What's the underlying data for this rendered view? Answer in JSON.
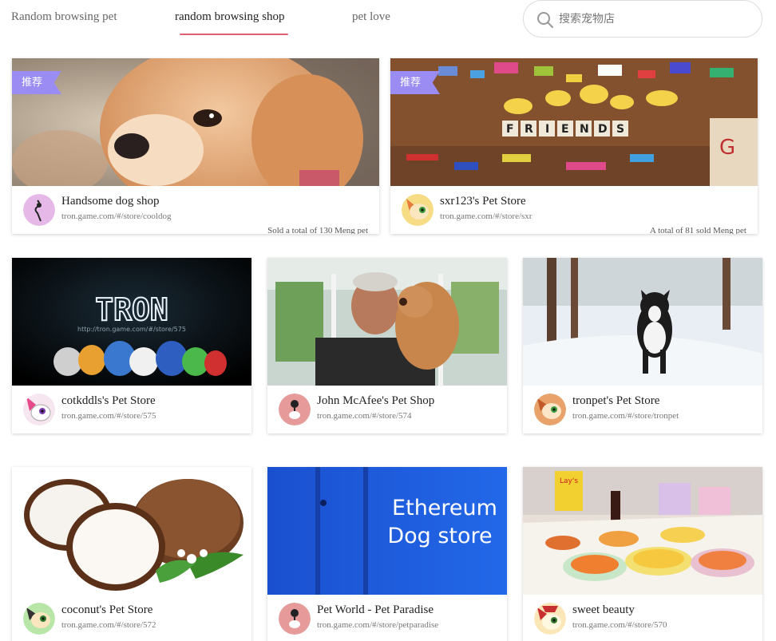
{
  "nav": {
    "tabs": [
      {
        "label": "Random browsing pet"
      },
      {
        "label": "random browsing shop"
      },
      {
        "label": "pet love"
      }
    ],
    "active_tab": "random browsing shop",
    "accent_color": "#e0606e"
  },
  "search": {
    "placeholder": "搜索宠物店",
    "value": ""
  },
  "badge_color": "#9a8cf2",
  "featured": [
    {
      "badge": "推荐",
      "name": "Handsome dog shop",
      "url": "tron.game.com/#/store/cooldog",
      "sold": "Sold a total of 130 Meng pet",
      "image": "puppy-photo",
      "avatar": "cat-avatar-purple"
    },
    {
      "badge": "推荐",
      "name": "sxr123's Pet Store",
      "url": "tron.game.com/#/store/sxr",
      "sold": "A total of 81 sold Meng pet",
      "image": "toys-friends-photo",
      "avatar": "cat-avatar-yellow"
    }
  ],
  "stores": [
    {
      "name": "cotkddls's Pet Store",
      "url": "tron.game.com/#/store/575",
      "image": "tron-banner",
      "image_text": "TRON",
      "image_subtext": "http://tron.game.com/#/store/575",
      "avatar": "cat-avatar-pink"
    },
    {
      "name": "John McAfee's Pet Shop",
      "url": "tron.game.com/#/store/574",
      "image": "man-with-dog-photo",
      "avatar": "cat-avatar-red"
    },
    {
      "name": "tronpet's Pet Store",
      "url": "tron.game.com/#/store/tronpet",
      "image": "dog-in-snow-photo",
      "avatar": "cat-avatar-orange"
    },
    {
      "name": "coconut's Pet Store",
      "url": "tron.game.com/#/store/572",
      "image": "coconut-photo",
      "avatar": "cat-avatar-green"
    },
    {
      "name": "Pet World - Pet Paradise",
      "url": "tron.game.com/#/store/petparadise",
      "image": "ethereum-dog-store-banner",
      "image_text_line1": "Ethereum",
      "image_text_line2": "Dog store",
      "avatar": "cat-avatar-red"
    },
    {
      "name": "sweet beauty",
      "url": "tron.game.com/#/store/570",
      "image": "food-table-photo",
      "avatar": "cat-avatar-cream"
    }
  ]
}
